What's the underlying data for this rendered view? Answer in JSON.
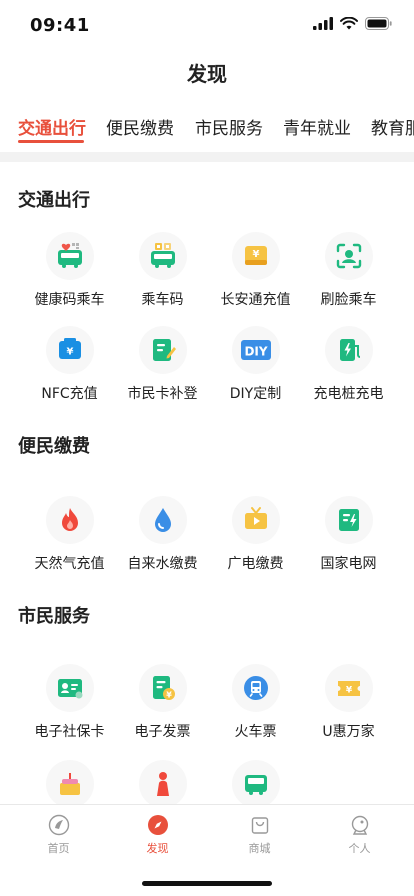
{
  "status_bar": {
    "time": "09:41"
  },
  "page": {
    "title": "发现"
  },
  "tabs": [
    {
      "label": "交通出行",
      "active": true
    },
    {
      "label": "便民缴费",
      "active": false
    },
    {
      "label": "市民服务",
      "active": false
    },
    {
      "label": "青年就业",
      "active": false
    },
    {
      "label": "教育服",
      "active": false
    }
  ],
  "sections": [
    {
      "title": "交通出行",
      "items": [
        {
          "label": "健康码乘车",
          "icon": "health-code-bus-icon"
        },
        {
          "label": "乘车码",
          "icon": "bus-code-icon"
        },
        {
          "label": "长安通充值",
          "icon": "card-recharge-icon"
        },
        {
          "label": "刷脸乘车",
          "icon": "face-scan-icon"
        },
        {
          "label": "NFC充值",
          "icon": "nfc-recharge-icon"
        },
        {
          "label": "市民卡补登",
          "icon": "card-edit-icon"
        },
        {
          "label": "DIY定制",
          "icon": "diy-icon",
          "text": "DIY"
        },
        {
          "label": "充电桩充电",
          "icon": "charging-pile-icon"
        }
      ]
    },
    {
      "title": "便民缴费",
      "items": [
        {
          "label": "天然气充值",
          "icon": "gas-flame-icon"
        },
        {
          "label": "自来水缴费",
          "icon": "water-drop-icon"
        },
        {
          "label": "广电缴费",
          "icon": "tv-icon"
        },
        {
          "label": "国家电网",
          "icon": "power-grid-icon"
        }
      ]
    },
    {
      "title": "市民服务",
      "items": [
        {
          "label": "电子社保卡",
          "icon": "social-security-card-icon"
        },
        {
          "label": "电子发票",
          "icon": "e-invoice-icon"
        },
        {
          "label": "火车票",
          "icon": "train-ticket-icon"
        },
        {
          "label": "U惠万家",
          "icon": "coupon-icon"
        },
        {
          "label": "",
          "icon": "cake-icon"
        },
        {
          "label": "",
          "icon": "person-icon"
        },
        {
          "label": "",
          "icon": "bus-icon"
        }
      ]
    }
  ],
  "tabbar": [
    {
      "label": "首页",
      "icon": "home-icon",
      "active": false
    },
    {
      "label": "发现",
      "icon": "compass-icon",
      "active": true
    },
    {
      "label": "商城",
      "icon": "shop-bag-icon",
      "active": false
    },
    {
      "label": "个人",
      "icon": "profile-icon",
      "active": false
    }
  ],
  "colors": {
    "accent": "#e8503c",
    "green": "#1fb980",
    "yellow": "#f6c343",
    "blue": "#3a8ee6"
  }
}
